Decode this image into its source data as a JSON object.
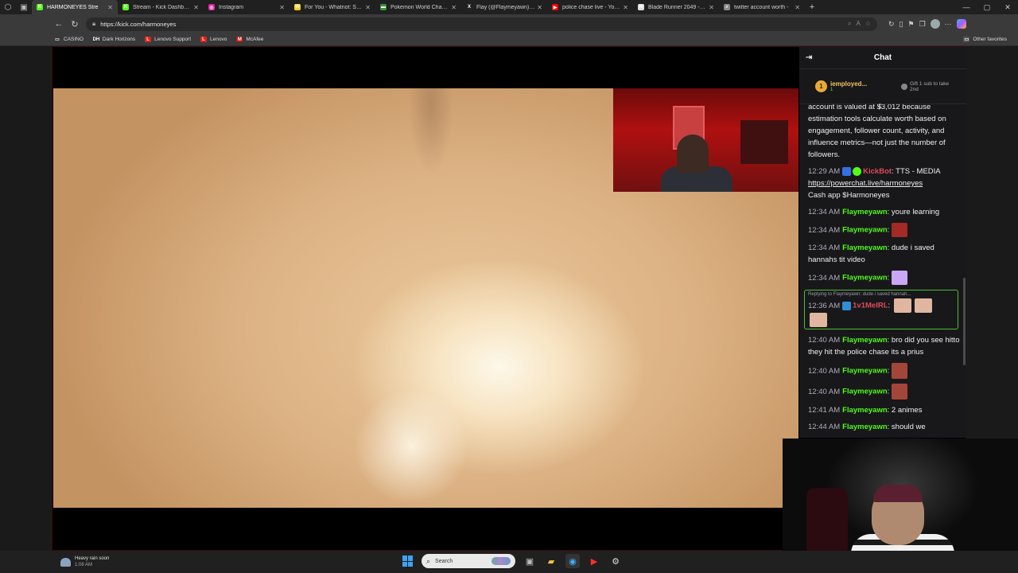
{
  "tabstrip": {
    "tabs": [
      {
        "title": "HARMONEYES Stre",
        "fav_color": "#53fc18",
        "fav_glyph": "K",
        "active": true
      },
      {
        "title": "Stream - Kick Dashboard",
        "fav_color": "#53fc18",
        "fav_glyph": "K"
      },
      {
        "title": "Instagram",
        "fav_color": "#d6249f",
        "fav_glyph": "◎"
      },
      {
        "title": "For You - Whatnot: Shop",
        "fav_color": "#f5d020",
        "fav_glyph": "W"
      },
      {
        "title": "Pokemon World Champi",
        "fav_color": "#3a8f3a",
        "fav_glyph": "▬"
      },
      {
        "title": "Flay (@Flaymeyawn) / X",
        "fav_color": "#222222",
        "fav_glyph": "X"
      },
      {
        "title": "police chase live - YouTu",
        "fav_color": "#ff0000",
        "fav_glyph": "▶"
      },
      {
        "title": "Blade Runner 2049 - Wiki",
        "fav_color": "#dddddd",
        "fav_glyph": "W"
      },
      {
        "title": "twitter account worth - ",
        "fav_color": "#888888",
        "fav_glyph": "⌕"
      }
    ]
  },
  "address": {
    "url": "https://kick.com/harmoneyes"
  },
  "bookmarks": [
    {
      "label": "CASINO",
      "color": "#3a3a3a",
      "glyph": "▭"
    },
    {
      "label": "Dark Horizons",
      "color": "#333333",
      "glyph": "DH"
    },
    {
      "label": "Lenovo Support",
      "color": "#e2231a",
      "glyph": "L"
    },
    {
      "label": "Lenovo",
      "color": "#e2231a",
      "glyph": "L"
    },
    {
      "label": "McAfee",
      "color": "#c01818",
      "glyph": "M"
    }
  ],
  "bookmarks_other": "Other favorites",
  "chat": {
    "title": "Chat",
    "gift": {
      "rank": "1",
      "user": "iemployed...",
      "count": "1",
      "cta": "Gift 1 sub to take 2nd"
    },
    "partial_top": "account is valued at $3,012 because estimation tools calculate worth based on engagement, follower count, activity, and influence metrics—not just the number of followers.",
    "messages": [
      {
        "time": "12:29 AM",
        "user": "KickBot",
        "text": ": TTS - MEDIA",
        "link": "https://powerchat.live/harmoneyes",
        "text2": "Cash app $Harmoneyes"
      },
      {
        "time": "12:34 AM",
        "user": "Flaymeyawn",
        "text": ": youre learning"
      },
      {
        "time": "12:34 AM",
        "user": "Flaymeyawn",
        "text": ":"
      },
      {
        "time": "12:34 AM",
        "user": "Flaymeyawn",
        "text": ": dude i saved hannahs tit video"
      },
      {
        "time": "12:34 AM",
        "user": "Flaymeyawn",
        "text": ":"
      },
      {
        "time": "12:36 AM",
        "user": "1v1MeIRL",
        "text": ":",
        "reply_to": "Replying to Flaymeyawn: dude i saved hannah..."
      },
      {
        "time": "12:40 AM",
        "user": "Flaymeyawn",
        "text": ": bro did you see hitto they hit the police chase its a prius"
      },
      {
        "time": "12:40 AM",
        "user": "Flaymeyawn",
        "text": ":"
      },
      {
        "time": "12:40 AM",
        "user": "Flaymeyawn",
        "text": ":"
      },
      {
        "time": "12:41 AM",
        "user": "Flaymeyawn",
        "text": ": 2 animes"
      },
      {
        "time": "12:44 AM",
        "user": "Flaymeyawn",
        "text": ": should we"
      }
    ]
  },
  "taskbar": {
    "weather_title": "Heavy rain soon",
    "weather_time": "1:08 AM",
    "search_placeholder": "Search"
  },
  "colors": {
    "kick_green": "#53fc18",
    "chat_bg": "#18181b",
    "kickbot_red": "#e04a5a"
  }
}
